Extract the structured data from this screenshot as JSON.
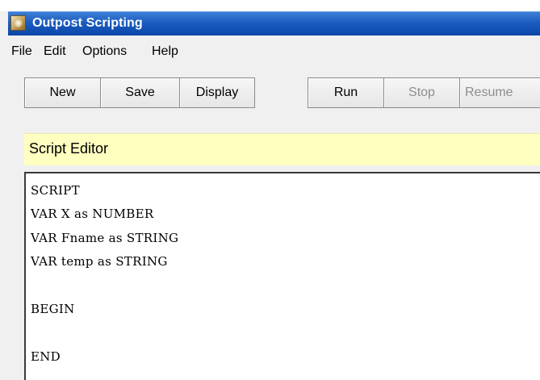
{
  "window": {
    "title": "Outpost Scripting"
  },
  "menu": {
    "items": [
      "File",
      "Edit",
      "Options",
      "Help"
    ]
  },
  "toolbar": {
    "new_label": "New",
    "save_label": "Save",
    "display_label": "Display",
    "run_label": "Run",
    "stop_label": "Stop",
    "resume_label": "Resume"
  },
  "editor": {
    "header": "Script Editor",
    "lines": [
      "SCRIPT",
      "VAR X as NUMBER",
      "VAR Fname as STRING",
      "VAR temp as STRING",
      "",
      "BEGIN",
      "",
      "END"
    ]
  },
  "colors": {
    "title_bar": "#1c5cc0",
    "editor_header_bg": "#ffffc0",
    "disabled_text": "#8d8d8d"
  }
}
